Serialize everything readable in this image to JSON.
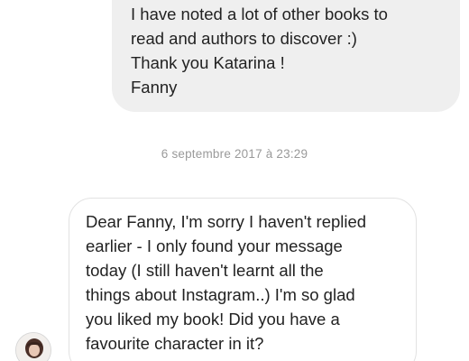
{
  "messages": {
    "sent": {
      "lines": [
        "I have noted a lot of other books to",
        "read and authors to discover :)",
        "Thank you Katarina !",
        "Fanny"
      ]
    },
    "timestamp": "6 septembre 2017 à 23:29",
    "received": {
      "lines": [
        "Dear Fanny, I'm sorry I haven't replied",
        "earlier - I only found your message",
        "today (I still haven't learnt all the",
        "things about Instagram..) I'm so glad",
        "you liked my book! Did you have a",
        "favourite character in it?"
      ]
    }
  },
  "colors": {
    "sent_bubble": "#efefef",
    "received_border": "#e2e2e2",
    "timestamp": "#9a9a9a",
    "text": "#222222"
  },
  "icons": {
    "avatar": "profile-photo"
  }
}
